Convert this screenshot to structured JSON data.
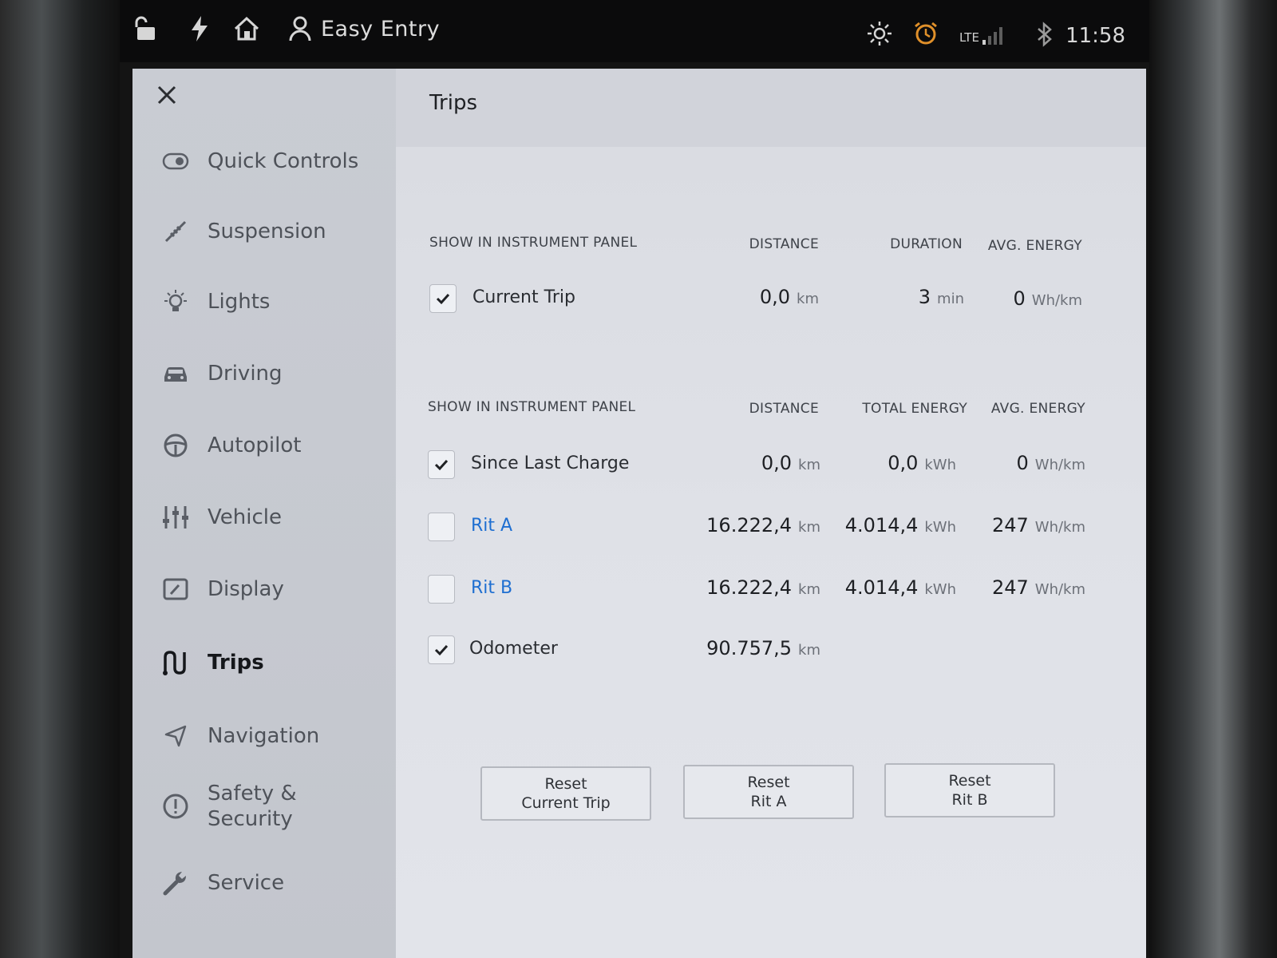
{
  "status_bar": {
    "profile_name": "Easy Entry",
    "network": "LTE",
    "time": "11:58"
  },
  "sidebar": {
    "items": [
      {
        "label": "Quick Controls",
        "icon": "toggle-icon"
      },
      {
        "label": "Suspension",
        "icon": "suspension-icon"
      },
      {
        "label": "Lights",
        "icon": "light-bulb-icon"
      },
      {
        "label": "Driving",
        "icon": "car-icon"
      },
      {
        "label": "Autopilot",
        "icon": "steering-wheel-icon"
      },
      {
        "label": "Vehicle",
        "icon": "sliders-icon"
      },
      {
        "label": "Display",
        "icon": "display-icon"
      },
      {
        "label": "Trips",
        "icon": "trips-icon",
        "active": true
      },
      {
        "label": "Navigation",
        "icon": "navigation-arrow-icon"
      },
      {
        "label": "Safety &\nSecurity",
        "icon": "alert-circle-icon"
      },
      {
        "label": "Service",
        "icon": "wrench-icon"
      }
    ]
  },
  "page": {
    "title": "Trips"
  },
  "section1": {
    "headers": {
      "show": "SHOW IN INSTRUMENT PANEL",
      "distance": "DISTANCE",
      "duration": "DURATION",
      "avg_energy": "AVG. ENERGY"
    },
    "rows": [
      {
        "label": "Current Trip",
        "checked": true,
        "distance": "0,0",
        "distance_unit": "km",
        "duration": "3",
        "duration_unit": "min",
        "avg_energy": "0",
        "avg_energy_unit": "Wh/km"
      }
    ]
  },
  "section2": {
    "headers": {
      "show": "SHOW IN INSTRUMENT PANEL",
      "distance": "DISTANCE",
      "total_energy": "TOTAL ENERGY",
      "avg_energy": "AVG. ENERGY"
    },
    "rows": [
      {
        "label": "Since Last Charge",
        "checked": true,
        "distance": "0,0",
        "distance_unit": "km",
        "total_energy": "0,0",
        "total_energy_unit": "kWh",
        "avg_energy": "0",
        "avg_energy_unit": "Wh/km"
      },
      {
        "label": "Rit A",
        "checked": false,
        "distance": "16.222,4",
        "distance_unit": "km",
        "total_energy": "4.014,4",
        "total_energy_unit": "kWh",
        "avg_energy": "247",
        "avg_energy_unit": "Wh/km"
      },
      {
        "label": "Rit B",
        "checked": false,
        "distance": "16.222,4",
        "distance_unit": "km",
        "total_energy": "4.014,4",
        "total_energy_unit": "kWh",
        "avg_energy": "247",
        "avg_energy_unit": "Wh/km"
      },
      {
        "label": "Odometer",
        "checked": true,
        "distance": "90.757,5",
        "distance_unit": "km"
      }
    ]
  },
  "buttons": {
    "reset_current_trip": [
      "Reset",
      "Current Trip"
    ],
    "reset_rit_a": [
      "Reset",
      "Rit A"
    ],
    "reset_rit_b": [
      "Reset",
      "Rit B"
    ]
  },
  "colors": {
    "accent_link": "#1f6fd1",
    "alarm_icon": "#e0902a"
  }
}
